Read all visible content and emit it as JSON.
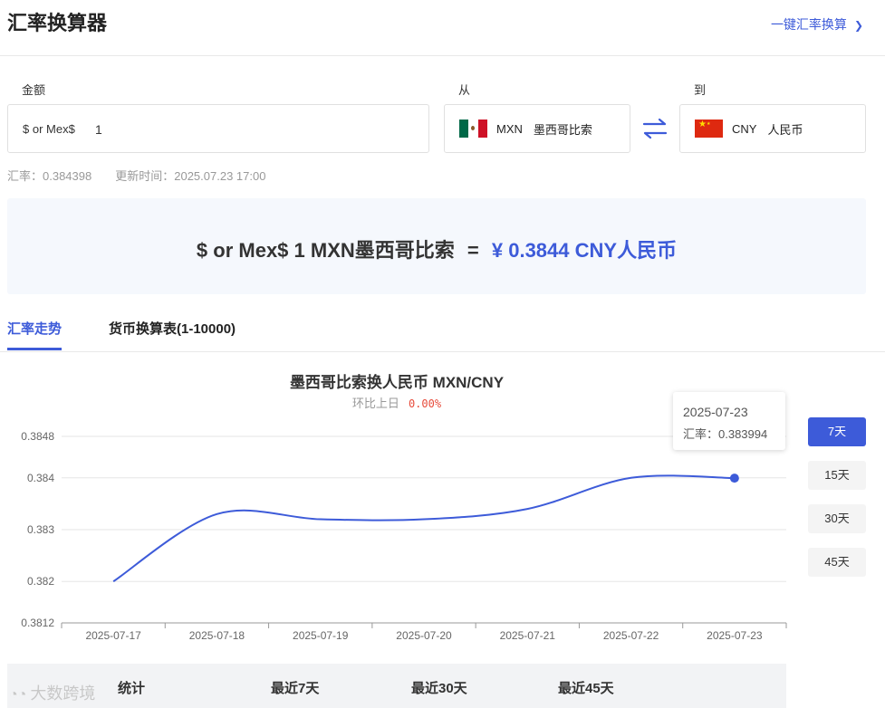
{
  "header": {
    "title": "汇率换算器",
    "quick_link": "一键汇率换算"
  },
  "form": {
    "amount_label": "金额",
    "from_label": "从",
    "to_label": "到",
    "amount_prefix": "$ or Mex$",
    "amount_value": "1",
    "from_code": "MXN",
    "from_name": "墨西哥比索",
    "to_code": "CNY",
    "to_name": "人民币"
  },
  "meta": {
    "rate_text": "汇率：0.384398",
    "updated_text": "更新时间：2025.07.23 17:00"
  },
  "result": {
    "left": "$ or Mex$ 1 MXN墨西哥比索",
    "eq": "=",
    "right": "¥ 0.3844 CNY人民币"
  },
  "tabs": [
    "汇率走势",
    "货币换算表(1-10000)"
  ],
  "chart": {
    "title": "墨西哥比索换人民币   MXN/CNY",
    "sub_label": "环比上日",
    "sub_pct": "0.00%",
    "tooltip_date": "2025-07-23",
    "tooltip_rate": "汇率：0.383994"
  },
  "ranges": [
    "7天",
    "15天",
    "30天",
    "45天"
  ],
  "stats": {
    "c1": "统计",
    "c2": "最近7天",
    "c3": "最近30天",
    "c4": "最近45天"
  },
  "watermark": "大数跨境",
  "colors": {
    "accent": "#3d5bd9",
    "up": "#e74c3c"
  },
  "chart_data": {
    "type": "line",
    "x": [
      "2025-07-17",
      "2025-07-18",
      "2025-07-19",
      "2025-07-20",
      "2025-07-21",
      "2025-07-22",
      "2025-07-23"
    ],
    "y_ticks": [
      "0.3812",
      "0.382",
      "0.383",
      "0.384",
      "0.3848"
    ],
    "series": [
      {
        "values": [
          0.382,
          0.3833,
          0.3832,
          0.3832,
          0.3834,
          0.384,
          0.383994
        ]
      }
    ],
    "ylim": [
      0.3812,
      0.3848
    ],
    "grid": true
  }
}
